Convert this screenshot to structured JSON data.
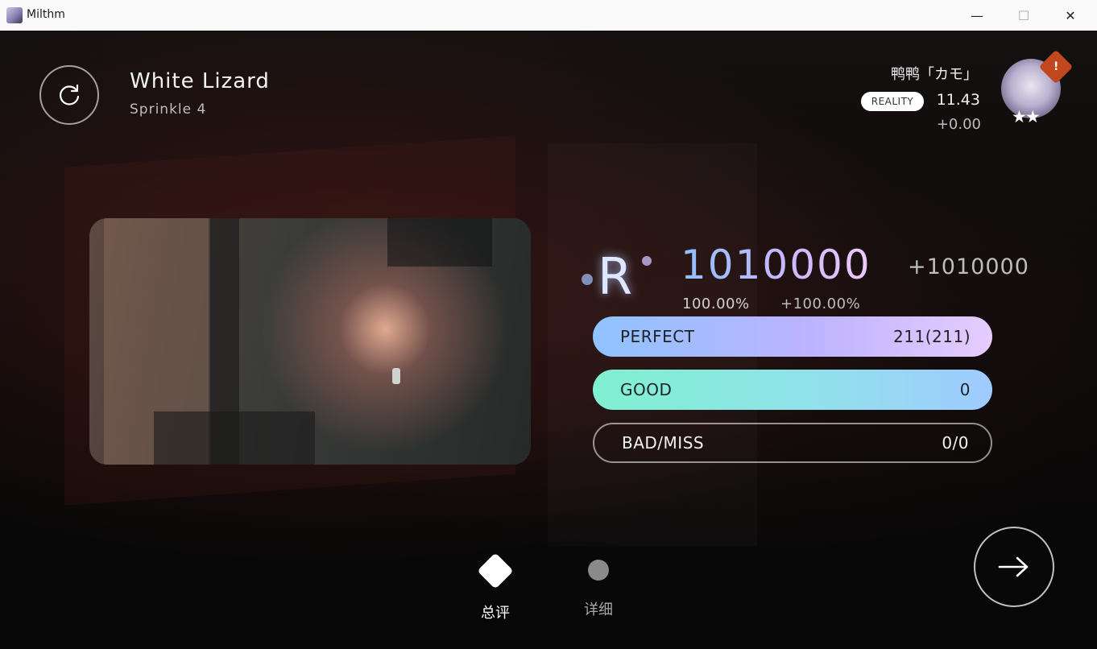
{
  "window": {
    "title": "Milthm",
    "minimize_glyph": "—",
    "maximize_glyph": "☐",
    "close_glyph": "✕"
  },
  "song": {
    "title": "White Lizard",
    "difficulty": "Sprinkle 4"
  },
  "player": {
    "name": "鸭鸭「カモ」",
    "badge": "REALITY",
    "rating": "11.43",
    "rating_delta": "+0.00",
    "alert_glyph": "!",
    "stars": "★★"
  },
  "result": {
    "rank": "R",
    "score": "1010000",
    "score_delta": "+1010000",
    "accuracy": "100.00%",
    "accuracy_delta": "+100.00%"
  },
  "judgements": [
    {
      "label": "PERFECT",
      "value": "211(211)"
    },
    {
      "label": "GOOD",
      "value": "0"
    },
    {
      "label": "BAD/MISS",
      "value": "0/0"
    }
  ],
  "tabs": [
    {
      "label": "总评",
      "active": true
    },
    {
      "label": "详细",
      "active": false
    }
  ],
  "icons": {
    "retry": "retry-icon",
    "next": "arrow-right-icon"
  },
  "colors": {
    "perfect_gradient_start": "#8fc3ff",
    "perfect_gradient_end": "#e6ccff",
    "good_gradient_start": "#7ff0d0",
    "good_gradient_end": "#9fcbff",
    "alert_badge": "#c0471e"
  }
}
